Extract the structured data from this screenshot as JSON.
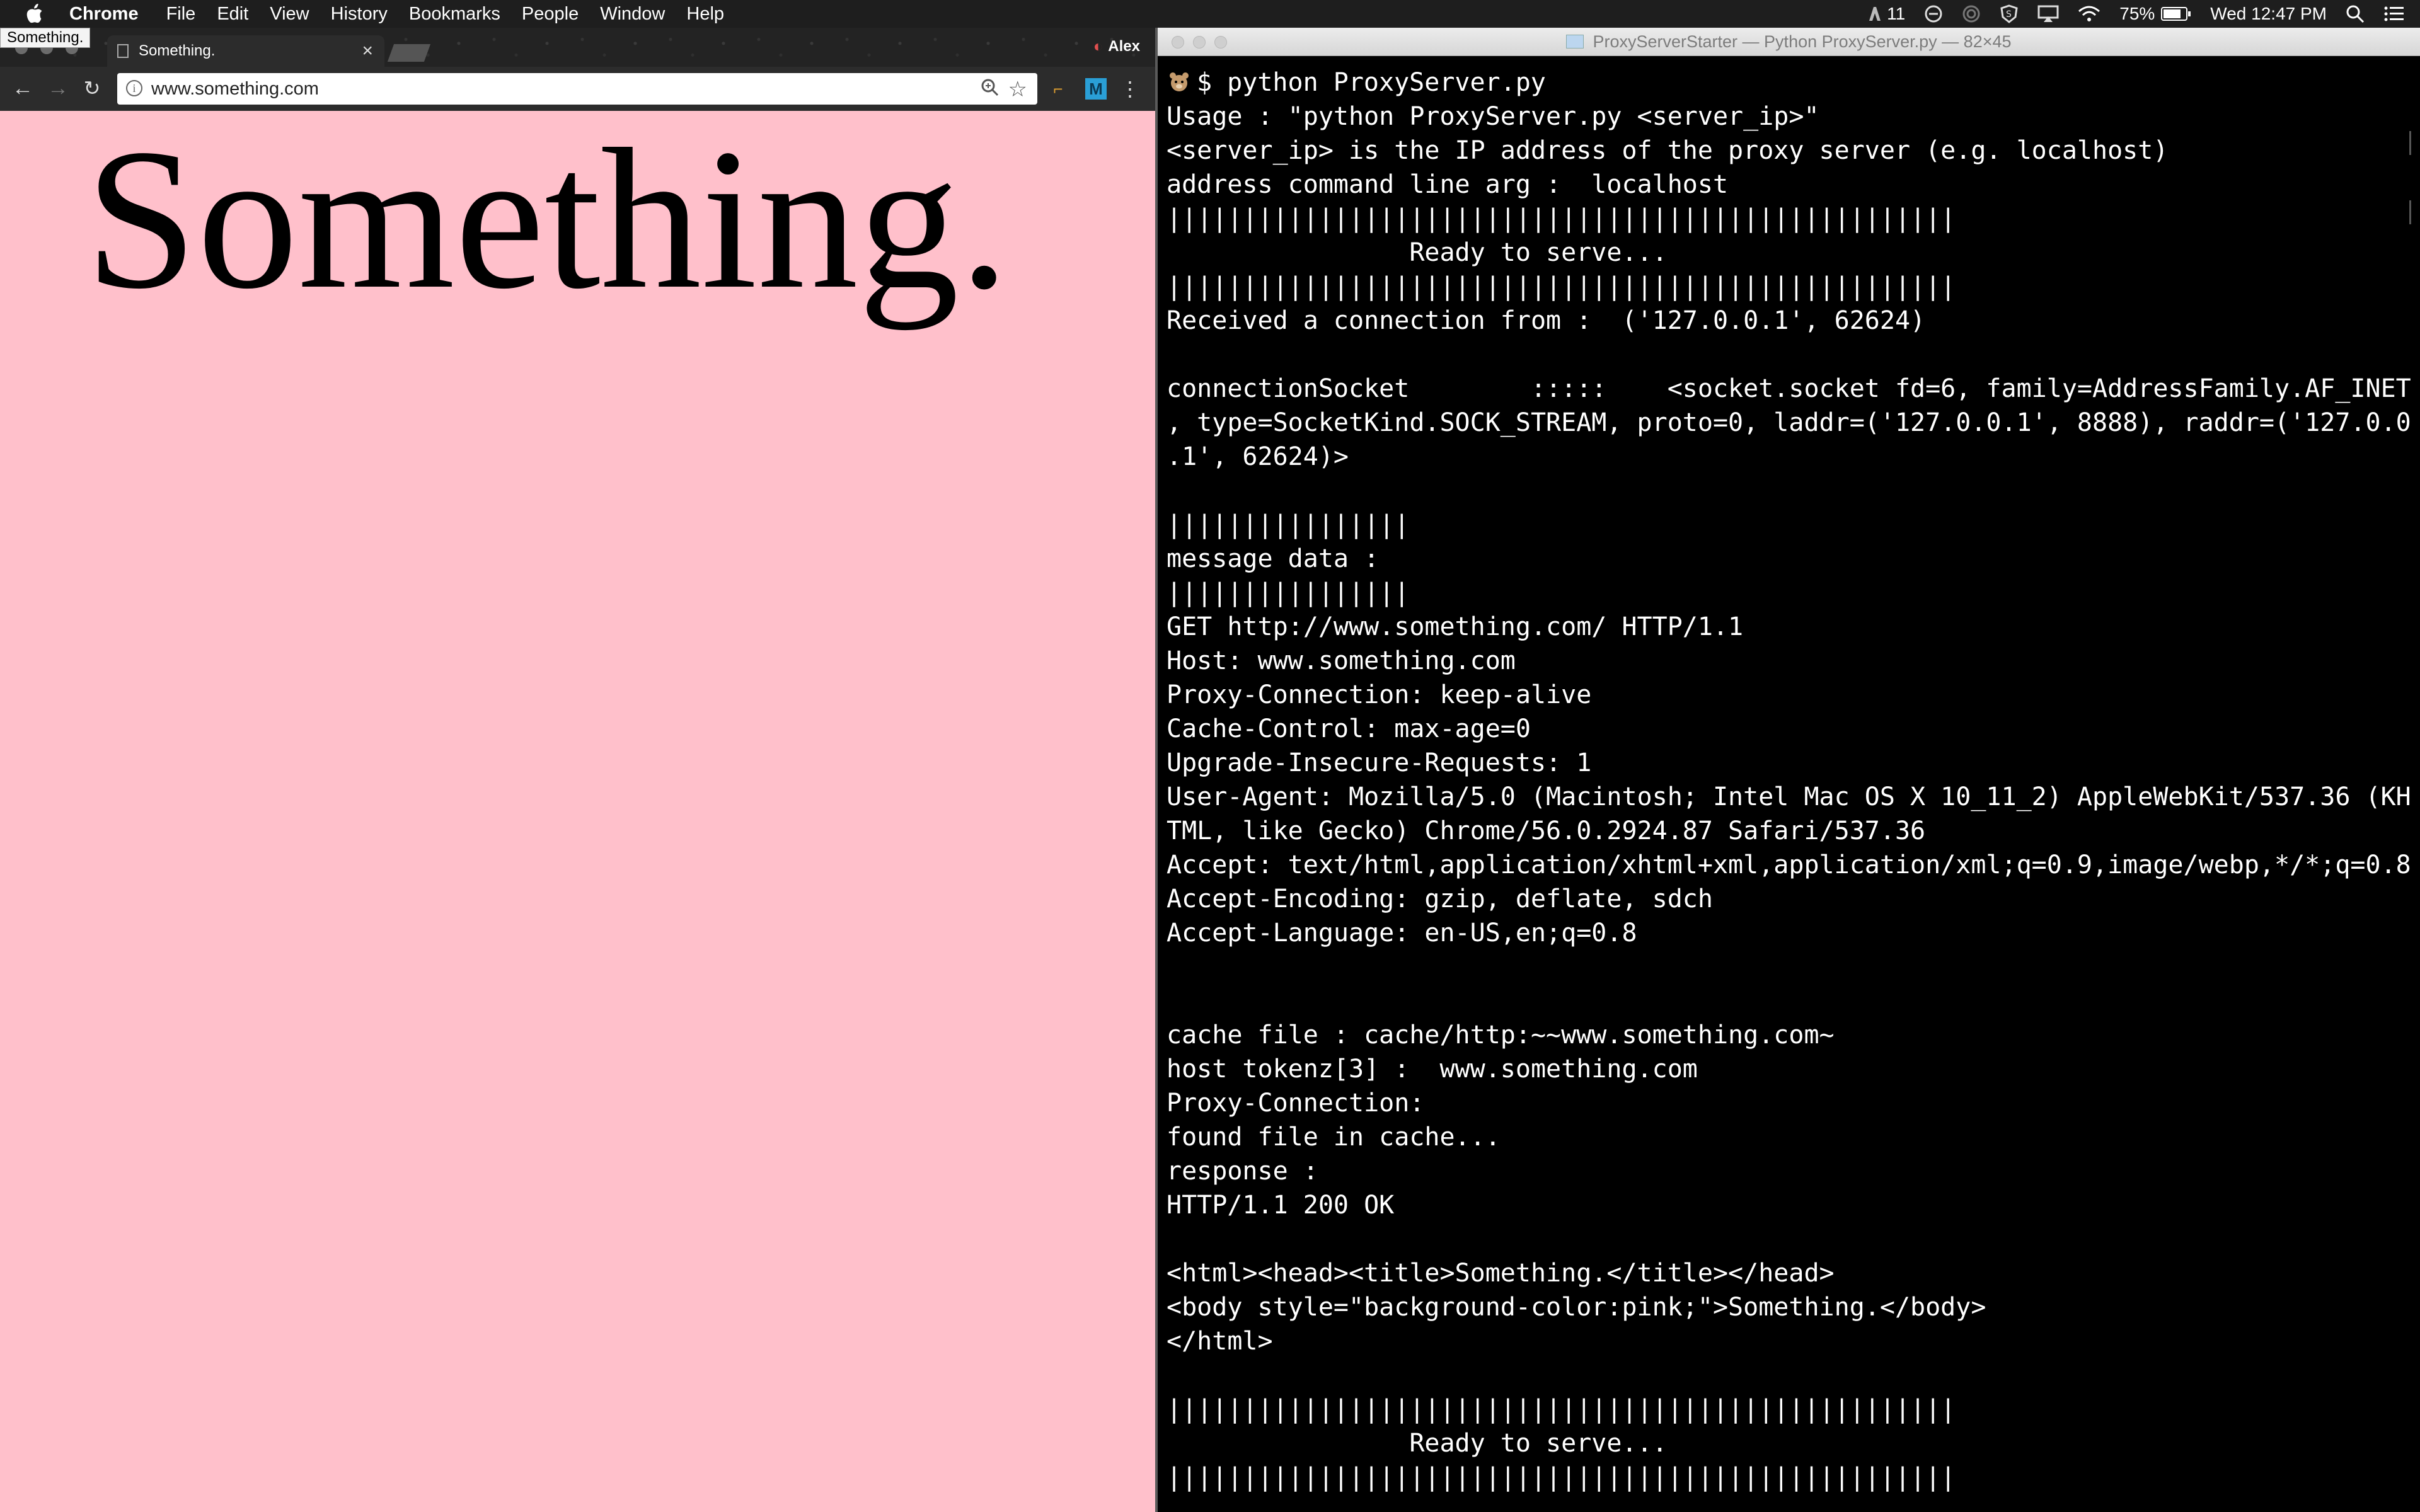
{
  "menubar": {
    "items": [
      "Chrome",
      "File",
      "Edit",
      "View",
      "History",
      "Bookmarks",
      "People",
      "Window",
      "Help"
    ],
    "notification_count": "11",
    "battery": "75%",
    "clock": "Wed 12:47 PM"
  },
  "chrome": {
    "tooltip": "Something.",
    "tab_title": "Something.",
    "tab_close": "×",
    "profile_name": "Alex",
    "url": "www.something.com",
    "page_heading": "Something.",
    "page_background": "#ffc0cb",
    "icons": [
      "back-icon",
      "forward-icon",
      "reload-icon",
      "info-icon",
      "zoom-icon",
      "star-icon",
      "menu-icon"
    ]
  },
  "terminal": {
    "title": "ProxyServerStarter — Python ProxyServer.py — 82×45",
    "prompt": "$ python ProxyServer.py",
    "lines": [
      "Usage : \"python ProxyServer.py <server_ip>\"",
      "<server_ip> is the IP address of the proxy server (e.g. localhost)",
      "address command line arg :  localhost",
      "||||||||||||||||||||||||||||||||||||||||||||||||||||",
      "                Ready to serve...",
      "||||||||||||||||||||||||||||||||||||||||||||||||||||",
      "Received a connection from :  ('127.0.0.1', 62624)",
      "",
      "connectionSocket        :::::    <socket.socket fd=6, family=AddressFamily.AF_INET",
      ", type=SocketKind.SOCK_STREAM, proto=0, laddr=('127.0.0.1', 8888), raddr=('127.0.0",
      ".1', 62624)>",
      "",
      "||||||||||||||||",
      "message data :",
      "||||||||||||||||",
      "GET http://www.something.com/ HTTP/1.1",
      "Host: www.something.com",
      "Proxy-Connection: keep-alive",
      "Cache-Control: max-age=0",
      "Upgrade-Insecure-Requests: 1",
      "User-Agent: Mozilla/5.0 (Macintosh; Intel Mac OS X 10_11_2) AppleWebKit/537.36 (KH",
      "TML, like Gecko) Chrome/56.0.2924.87 Safari/537.36",
      "Accept: text/html,application/xhtml+xml,application/xml;q=0.9,image/webp,*/*;q=0.8",
      "Accept-Encoding: gzip, deflate, sdch",
      "Accept-Language: en-US,en;q=0.8",
      "",
      "",
      "cache file : cache/http:~~www.something.com~",
      "host tokenz[3] :  www.something.com",
      "Proxy-Connection:",
      "found file in cache...",
      "response :",
      "HTTP/1.1 200 OK",
      "",
      "<html><head><title>Something.</title></head>",
      "<body style=\"background-color:pink;\">Something.</body>",
      "</html>",
      "",
      "||||||||||||||||||||||||||||||||||||||||||||||||||||",
      "                Ready to serve...",
      "||||||||||||||||||||||||||||||||||||||||||||||||||||"
    ]
  }
}
